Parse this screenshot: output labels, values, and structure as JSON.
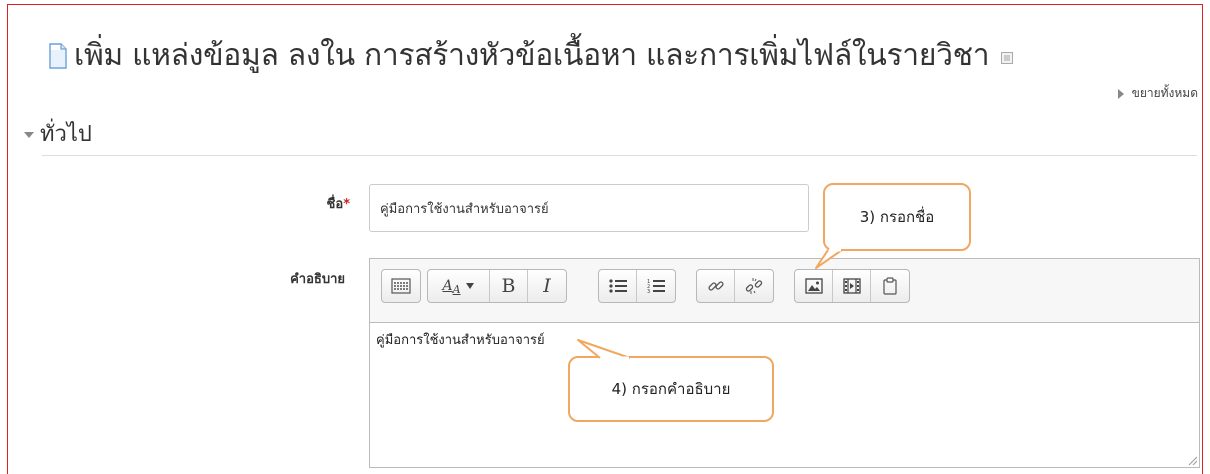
{
  "page": {
    "title": "เพิ่ม แหล่งข้อมูล ลงใน การสร้างหัวข้อเนื้อหา และการเพิ่มไฟล์ในรายวิชา",
    "expand_all": "ขยายทั้งหมด"
  },
  "section": {
    "title": "ทั่วไป"
  },
  "form": {
    "name_label": "ชื่อ",
    "required_mark": "*",
    "name_value": "คู่มือการใช้งานสำหรับอาจารย์",
    "description_label": "คำอธิบาย",
    "description_value": "คู่มือการใช้งานสำหรับอาจารย์",
    "font_size_button": "A",
    "bold_button": "B",
    "italic_button": "I"
  },
  "annotations": {
    "step3": "3) กรอกชื่อ",
    "step4": "4) กรอกคำอธิบาย",
    "border_color": "#f0a860"
  },
  "colors": {
    "frame_border": "#e02020",
    "required": "#cc1f1f"
  },
  "toolbar_icons": [
    "show-more-icon",
    "font-size-icon",
    "bold-icon",
    "italic-icon",
    "unordered-list-icon",
    "ordered-list-icon",
    "link-icon",
    "unlink-icon",
    "image-icon",
    "media-icon",
    "manage-files-icon"
  ]
}
